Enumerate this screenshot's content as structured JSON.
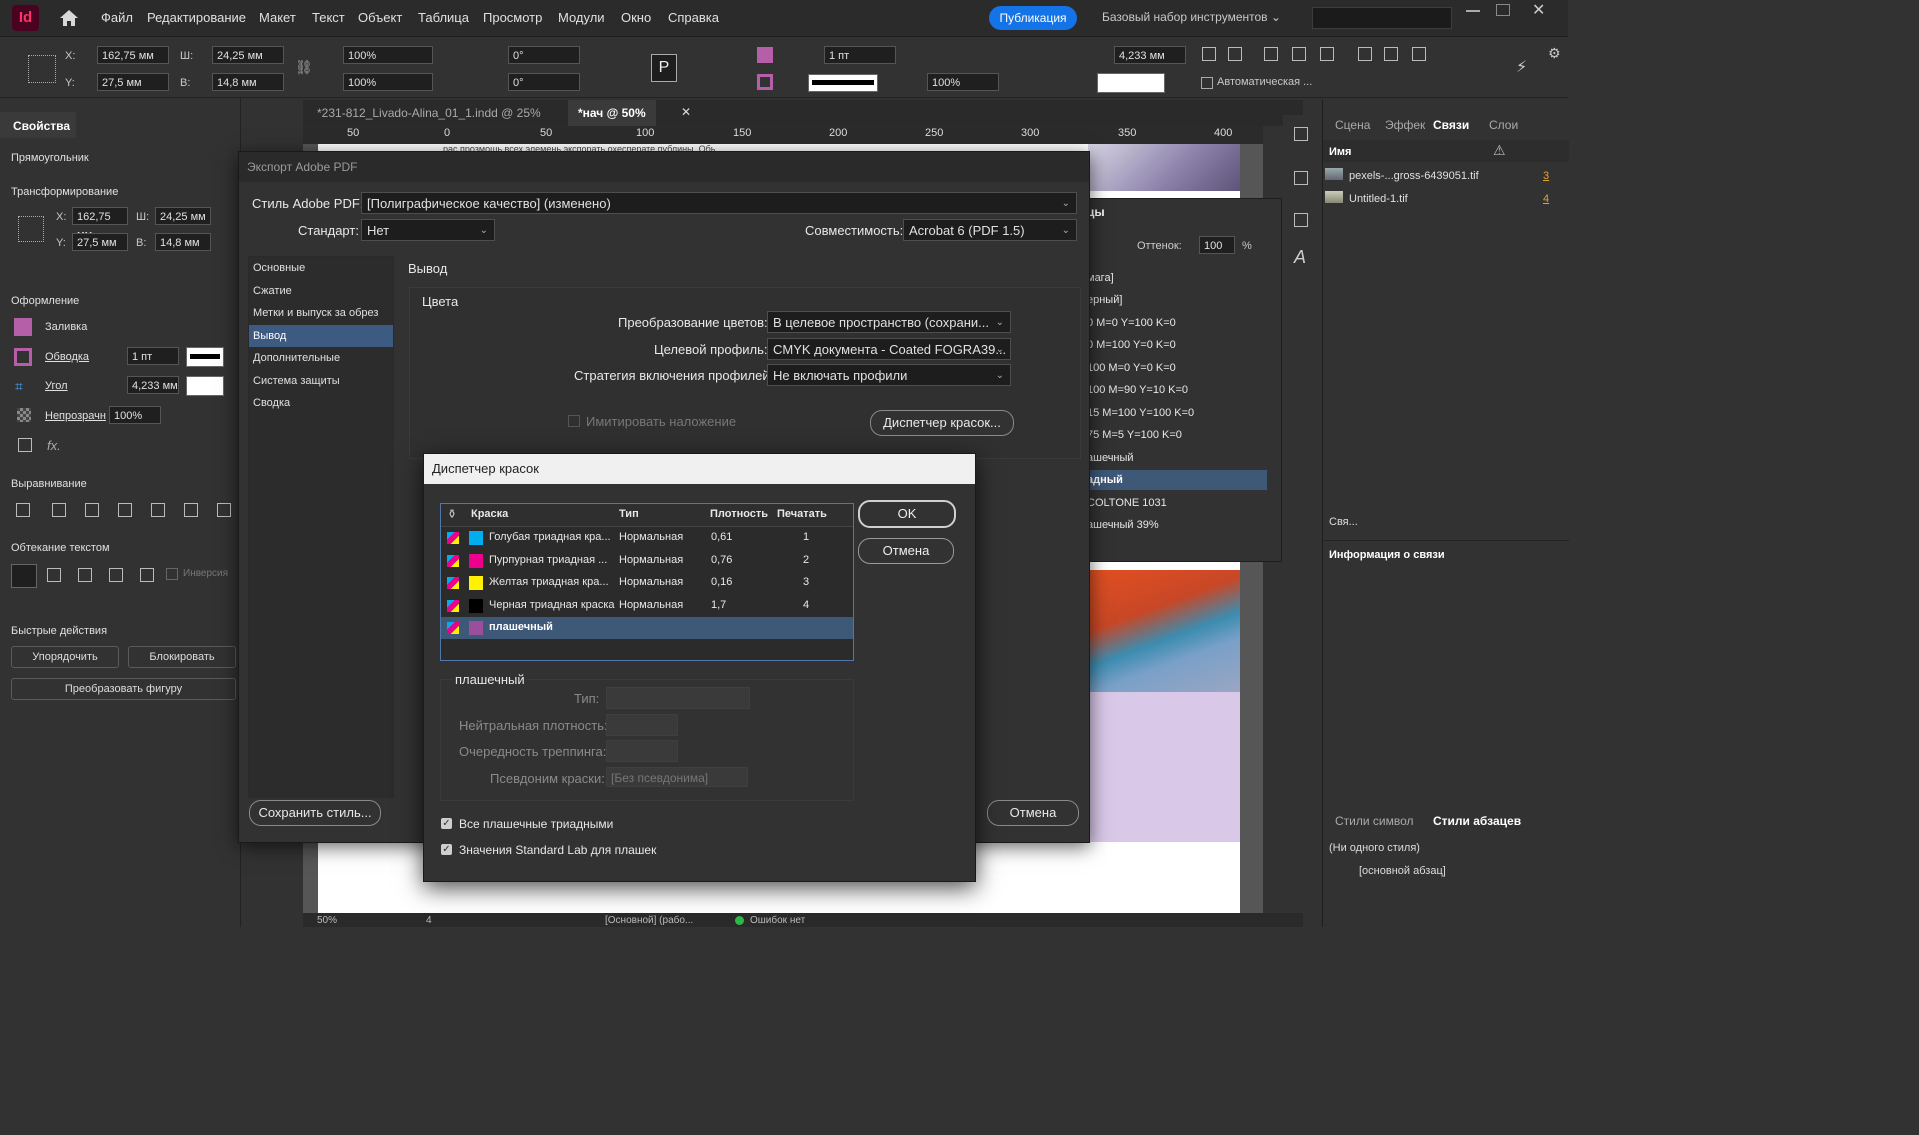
{
  "app": {
    "logo": "Id",
    "publish": "Публикация",
    "workspace": "Базовый набор инструментов ⌄"
  },
  "menu": [
    "Файл",
    "Редактирование",
    "Макет",
    "Текст",
    "Объект",
    "Таблица",
    "Просмотр",
    "Модули",
    "Окно",
    "Справка"
  ],
  "control": {
    "x": "162,75 мм",
    "y": "27,5 мм",
    "w": "24,25 мм",
    "h": "14,8 мм",
    "scale_x": "100%",
    "scale_y": "100%",
    "rot": "0°",
    "shear": "0°",
    "stroke": "1 пт",
    "corner": "4,233 мм",
    "opacity": "100%",
    "auto": "Автоматическая ...",
    "labels": {
      "x": "X:",
      "y": "Y:",
      "w": "Ш:",
      "h": "В:"
    }
  },
  "left": {
    "tab": "Свойства",
    "object": "Прямоугольник",
    "transform_title": "Трансформирование",
    "x": "162,75 мм",
    "y": "27,5 мм",
    "w": "24,25 мм",
    "h": "14,8 мм",
    "appearance_title": "Оформление",
    "fill": "Заливка",
    "stroke": "Обводка",
    "stroke_val": "1 пт",
    "corner": "Угол",
    "corner_val": "4,233 мм",
    "opacity": "Непрозрачн",
    "opacity_val": "100%",
    "align_title": "Выравнивание",
    "wrap_title": "Обтекание текстом",
    "invert": "Инверсия",
    "quick_title": "Быстрые действия",
    "btn_arrange": "Упорядочить",
    "btn_lock": "Блокировать",
    "btn_convert": "Преобразовать фигуру"
  },
  "tabs": [
    "*231-812_Livado-Alina_01_1.indd @ 25%",
    "*нач @ 50%"
  ],
  "ruler": [
    "50",
    "0",
    "50",
    "100",
    "150",
    "200",
    "250",
    "300",
    "350",
    "400"
  ],
  "status": {
    "zoom": "50%",
    "page": "4",
    "style": "[Основной] (рабо...",
    "errors": "Ошибок нет"
  },
  "swatches_panel": {
    "title": "цы",
    "tint_label": "Оттенок:",
    "tint": "100",
    "pct": "%",
    "rows": [
      "мага]",
      "ерный]",
      "0 M=0 Y=100 K=0",
      "0 M=100 Y=0 K=0",
      "100 M=0 Y=0 K=0",
      "100 M=90 Y=10 K=0",
      "15 M=100 Y=100 K=0",
      "75 M=5 Y=100 K=0",
      "ашечный",
      "адный",
      "COLTONE 1031",
      "ашечный 39%"
    ]
  },
  "right": {
    "tabs": [
      "Сцена",
      "Эффек",
      "Связи",
      "Слои"
    ],
    "name_col": "Имя",
    "links": [
      {
        "name": "pexels-...gross-6439051.tif",
        "page": "3"
      },
      {
        "name": "Untitled-1.tif",
        "page": "4"
      }
    ],
    "links_info": "Информация о связи",
    "links_footer": "Свя...",
    "style_tabs": [
      "Стили символ",
      "Стили абзацев"
    ],
    "styles": [
      "(Ни одного стиля)",
      "[основной абзац]"
    ]
  },
  "pdf": {
    "title": "Экспорт Adobe PDF",
    "style_label": "Стиль Adobe PDF:",
    "style_val": "[Полиграфическое качество] (изменено)",
    "std_label": "Стандарт:",
    "std_val": "Нет",
    "compat_label": "Совместимость:",
    "compat_val": "Acrobat 6 (PDF 1.5)",
    "categories": [
      "Основные",
      "Сжатие",
      "Метки и выпуск за обрез",
      "Вывод",
      "Дополнительные",
      "Система защиты",
      "Сводка"
    ],
    "section": "Вывод",
    "colors_group": "Цвета",
    "conv_label": "Преобразование цветов:",
    "conv_val": "В целевое пространство (сохрани...",
    "profile_label": "Целевой профиль:",
    "profile_val": "CMYK документа - Coated FOGRA39...",
    "strategy_label": "Стратегия включения профилей:",
    "strategy_val": "Не включать профили",
    "simulate": "Имитировать наложение",
    "ink_btn": "Диспетчер красок...",
    "save_style": "Сохранить стиль...",
    "cancel": "Отмена",
    "bg_text": "рас прозмошь всех элемень экспорать охесперате публины. Обь"
  },
  "ink": {
    "title": "Диспетчер красок",
    "cols": [
      "Краска",
      "Тип",
      "Плотность",
      "Печатать"
    ],
    "rows": [
      {
        "name": "Голубая триадная кра...",
        "type": "Нормальная",
        "density": "0,61",
        "seq": "1",
        "color": "#00aeef"
      },
      {
        "name": "Пурпурная триадная ...",
        "type": "Нормальная",
        "density": "0,76",
        "seq": "2",
        "color": "#ec008c"
      },
      {
        "name": "Желтая триадная кра...",
        "type": "Нормальная",
        "density": "0,16",
        "seq": "3",
        "color": "#fff200"
      },
      {
        "name": "Черная триадная краска",
        "type": "Нормальная",
        "density": "1,7",
        "seq": "4",
        "color": "#000000"
      },
      {
        "name": "плашечный",
        "type": "",
        "density": "",
        "seq": "",
        "color": "#9b4f9b"
      }
    ],
    "ok": "OK",
    "cancel": "Отмена",
    "group": "плашечный",
    "type_label": "Тип:",
    "neutral_label": "Нейтральная плотность:",
    "trap_label": "Очередность треппинга:",
    "alias_label": "Псевдоним краски:",
    "alias_val": "[Без псевдонима]",
    "cb1": "Все плашечные триадными",
    "cb2": "Значения Standard Lab для плашек"
  }
}
